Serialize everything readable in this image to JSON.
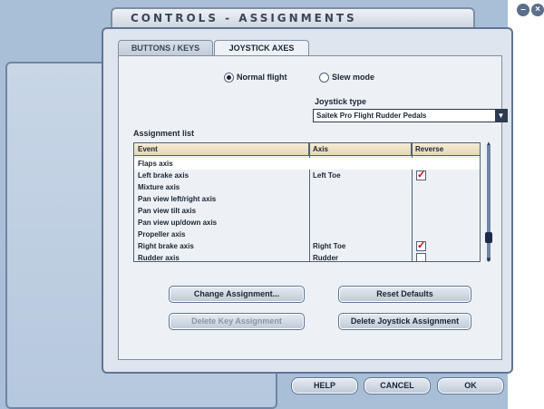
{
  "window": {
    "title": "CONTROLS - ASSIGNMENTS"
  },
  "tabs": [
    {
      "label": "BUTTONS / KEYS",
      "active": false
    },
    {
      "label": "JOYSTICK AXES",
      "active": true
    }
  ],
  "mode": {
    "options": [
      {
        "label": "Normal flight",
        "selected": true
      },
      {
        "label": "Slew mode",
        "selected": false
      }
    ]
  },
  "joystick_type": {
    "label": "Joystick type",
    "value": "Saitek Pro Flight Rudder Pedals",
    "arrow": "▼"
  },
  "assignment_list": {
    "label": "Assignment list",
    "columns": [
      "Event",
      "Axis",
      "Reverse"
    ],
    "rows": [
      {
        "event": "Flaps axis",
        "axis": "",
        "reverse": null,
        "selected": true
      },
      {
        "event": "Left brake axis",
        "axis": "Left Toe",
        "reverse": true
      },
      {
        "event": "Mixture axis",
        "axis": "",
        "reverse": null
      },
      {
        "event": "Pan view left/right axis",
        "axis": "",
        "reverse": null
      },
      {
        "event": "Pan view tilt axis",
        "axis": "",
        "reverse": null
      },
      {
        "event": "Pan view up/down axis",
        "axis": "",
        "reverse": null
      },
      {
        "event": "Propeller axis",
        "axis": "",
        "reverse": null
      },
      {
        "event": "Right brake axis",
        "axis": "Right Toe",
        "reverse": true
      },
      {
        "event": "Rudder axis",
        "axis": "Rudder",
        "reverse": false
      }
    ]
  },
  "buttons": {
    "change": "Change Assignment...",
    "reset": "Reset Defaults",
    "delete_key": "Delete Key Assignment",
    "delete_joystick": "Delete Joystick Assignment",
    "help": "HELP",
    "cancel": "CANCEL",
    "ok": "OK"
  },
  "colors": {
    "dialog_bg": "#dee5ee",
    "panel_bg": "#edf1f5",
    "header_bg": "#e6d8b6",
    "check_red": "#cc0000"
  }
}
